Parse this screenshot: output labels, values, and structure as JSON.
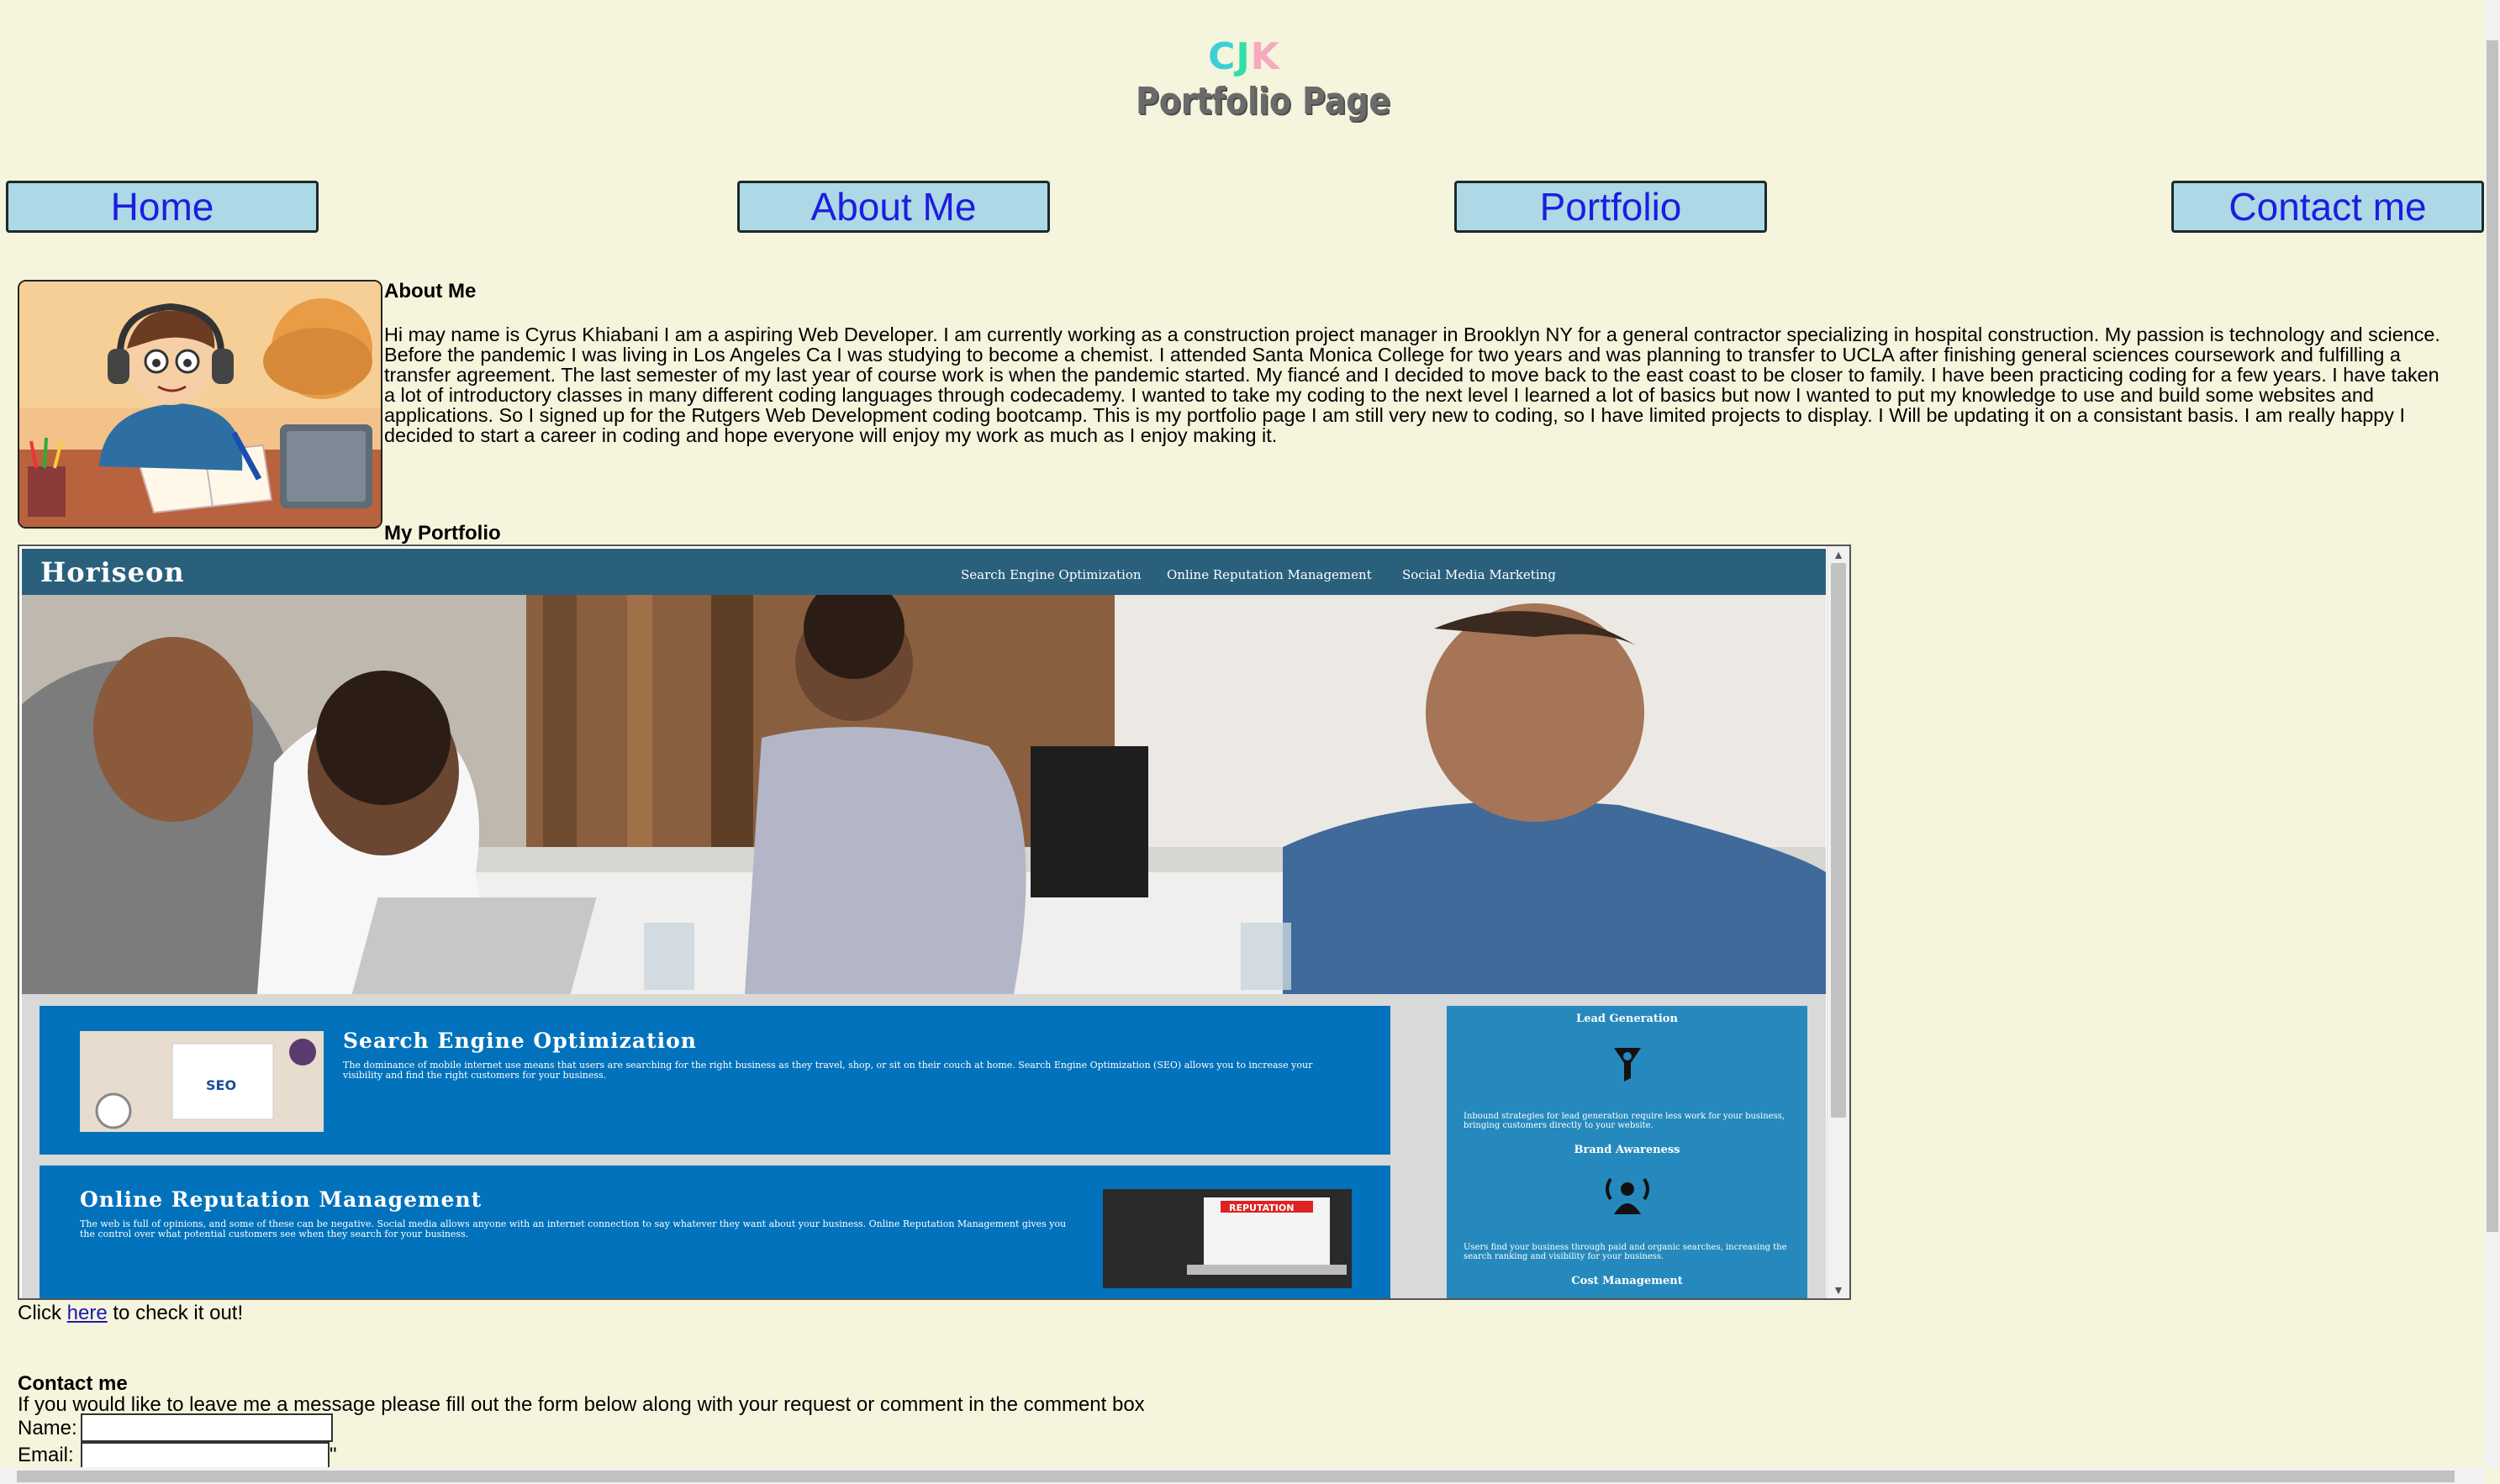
{
  "header": {
    "logo_letters": [
      "C",
      "J",
      "K"
    ],
    "title": "Portfolio Page"
  },
  "nav": {
    "items": [
      "Home",
      "About Me",
      "Portfolio",
      "Contact me"
    ]
  },
  "about": {
    "heading": "About Me",
    "text": "Hi may name is Cyrus Khiabani I am a aspiring Web Developer. I am currently working as a construction project manager in Brooklyn NY for a general contractor specializing in hospital construction. My passion is technology and science. Before the pandemic I was living in Los Angeles Ca I was studying to become a chemist. I attended Santa Monica College for two years and was planning to transfer to UCLA after finishing general sciences coursework and fulfilling a transfer agreement. The last semester of my last year of course work is when the pandemic started. My fiancé and I decided to move back to the east coast to be closer to family. I have been practicing coding for a few years. I have taken a lot of introductory classes in many different coding languages through codecademy. I wanted to take my coding to the next level I learned a lot of basics but now I wanted to put my knowledge to use and build some websites and applications. So I signed up for the Rutgers Web Development coding bootcamp. This is my portfolio page I am still very new to coding, so I have limited projects to display. I Will be updating it on a consistant basis. I am really happy I decided to start a career in coding and hope everyone will enjoy my work as much as I enjoy making it."
  },
  "portfolio": {
    "heading": "My Portfolio",
    "site": {
      "logo": "Horiseon",
      "nav": [
        "Search Engine Optimization",
        "Online Reputation Management",
        "Social Media Marketing"
      ],
      "cards": [
        {
          "title": "Search Engine Optimization",
          "text": "The dominance of mobile internet use means that users are searching for the right business as they travel, shop, or sit on their couch at home. Search Engine Optimization (SEO) allows you to increase your visibility and find the right customers for your business."
        },
        {
          "title": "Online Reputation Management",
          "text": "The web is full of opinions, and some of these can be negative. Social media allows anyone with an internet connection to say whatever they want about your business. Online Reputation Management gives you the control over what potential customers see when they search for your business."
        }
      ],
      "card_image_labels": [
        "SEO",
        "REPUTATION"
      ],
      "sidebar": {
        "items": [
          {
            "title": "Lead Generation",
            "text": "Inbound strategies for lead generation require less work for your business, bringing customers directly to your website."
          },
          {
            "title": "Brand Awareness",
            "text": "Users find your business through paid and organic searches, increasing the search ranking and visibility for your business."
          },
          {
            "title": "Cost Management",
            "text": ""
          }
        ]
      }
    },
    "click_prefix": "Click ",
    "click_link": "here",
    "click_suffix": " to check it out!"
  },
  "contact": {
    "heading": "Contact me",
    "intro": "If you would like to leave me a message please fill out the form below along with your request or comment in the comment box",
    "name_label": "Name:",
    "email_label": "Email:",
    "email_trailing": "\""
  },
  "colors": {
    "page_bg": "#f5f4dc",
    "nav_bg": "#add8e6",
    "nav_text": "#1d1de0",
    "horiseon_header": "#2a607c",
    "horiseon_card": "#0172bb",
    "horiseon_side": "#2589bd"
  }
}
